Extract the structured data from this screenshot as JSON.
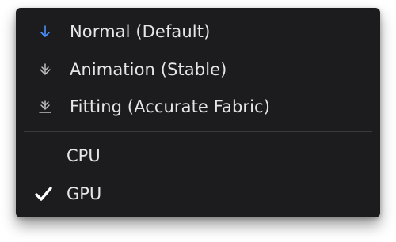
{
  "solver_modes": [
    {
      "label": "Normal (Default)",
      "icon": "arrow-down-icon",
      "icon_color": "#4a90ff"
    },
    {
      "label": "Animation (Stable)",
      "icon": "arrow-down-stable-icon",
      "icon_color": "#bfbfbf"
    },
    {
      "label": "Fitting (Accurate Fabric)",
      "icon": "arrow-down-fitting-icon",
      "icon_color": "#bfbfbf"
    }
  ],
  "devices": [
    {
      "label": "CPU",
      "checked": false
    },
    {
      "label": "GPU",
      "checked": true
    }
  ],
  "colors": {
    "menu_background": "#1c1c1e",
    "text": "#e6e6e6",
    "accent": "#4a90ff",
    "divider": "#3a3a3c"
  }
}
